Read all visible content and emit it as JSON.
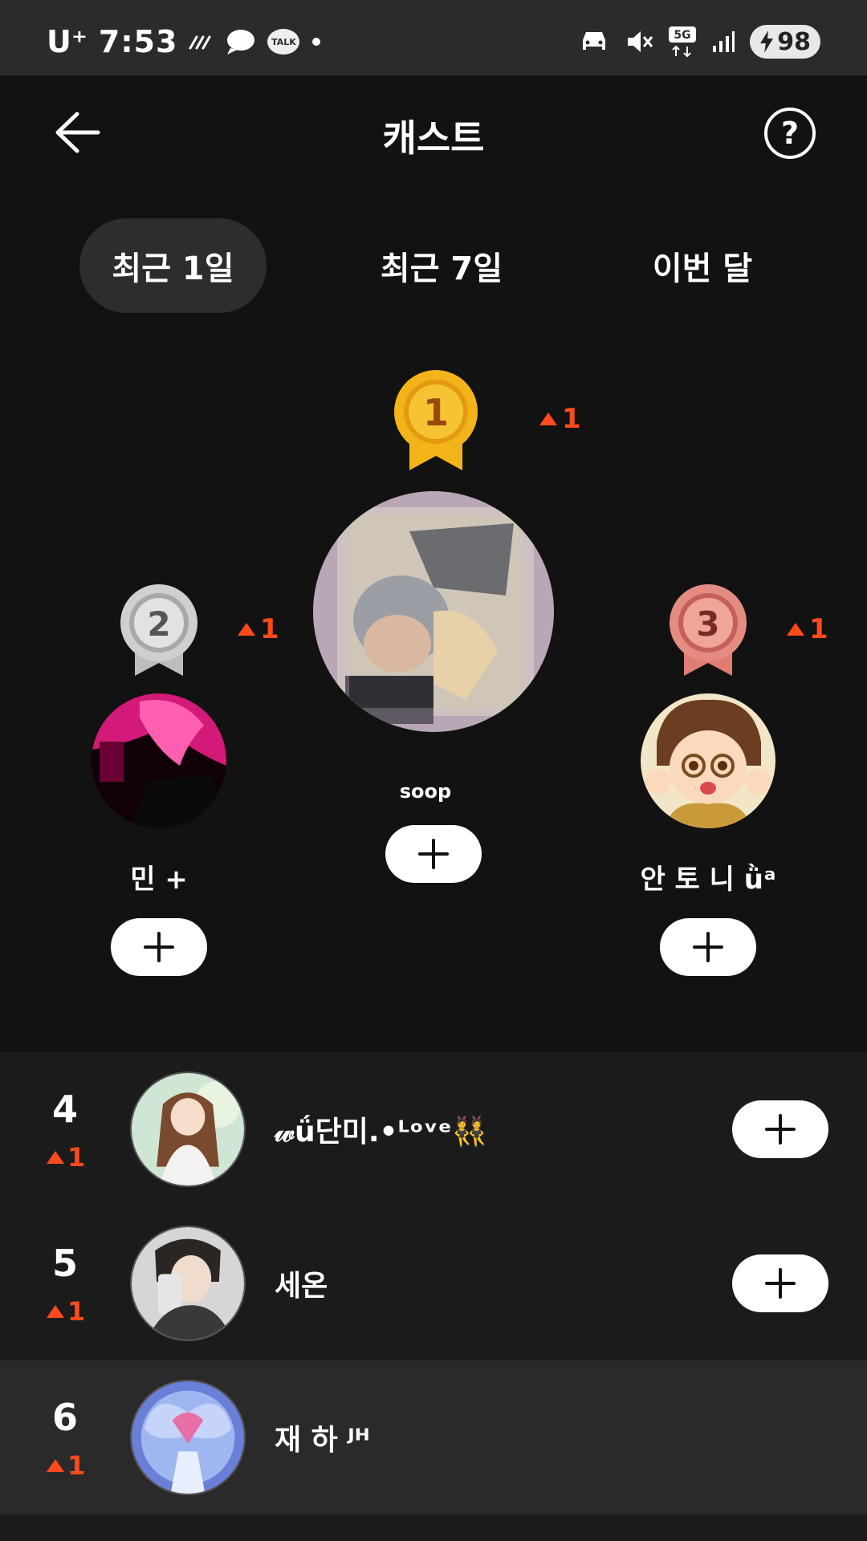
{
  "status_bar": {
    "carrier": "U⁺",
    "time": "7:53",
    "talk_icon_label": "TALK",
    "network": "5G",
    "battery": "98"
  },
  "header": {
    "title": "캐스트",
    "help_label": "?"
  },
  "tabs": [
    {
      "label": "최근 1일",
      "active": true
    },
    {
      "label": "최근 7일",
      "active": false
    },
    {
      "label": "이번 달",
      "active": false
    }
  ],
  "podium": {
    "first": {
      "rank": "1",
      "change": "1",
      "name": "soop",
      "medal_color": "#f2b418"
    },
    "second": {
      "rank": "2",
      "change": "1",
      "name": "민 +",
      "medal_color": "#c9c9c9"
    },
    "third": {
      "rank": "3",
      "change": "1",
      "name": "안 토 니 ǜᵃ",
      "medal_color": "#e07e74"
    }
  },
  "list": [
    {
      "rank": "4",
      "change": "1",
      "name": "𝓌ǘ단미.•ᴸᵒᵛᵉ👯",
      "follow": true
    },
    {
      "rank": "5",
      "change": "1",
      "name": "세온",
      "follow": true
    },
    {
      "rank": "6",
      "change": "1",
      "name": "재 하 ᴶᴴ",
      "follow": false
    }
  ],
  "colors": {
    "accent": "#ff4a1c",
    "background": "#121212",
    "row": "#1b1b1b",
    "row_highlight": "#2a2a2a"
  }
}
